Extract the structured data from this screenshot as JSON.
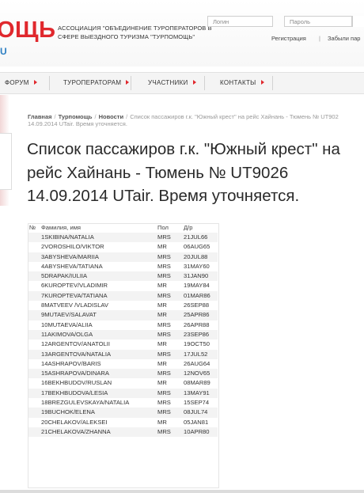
{
  "header": {
    "logo_text": "ОЩЬ",
    "logo_domain": "U",
    "association_text": "Ассоциация \"Объединение туроператоров в сфере выездного туризма \"ТУРПОМОЩЬ\"",
    "login_placeholder": "Логин",
    "password_placeholder": "Пароль",
    "register_link": "Регистрация",
    "divider": "|",
    "forgot_link": "Забыли пар"
  },
  "nav": {
    "items": [
      {
        "label": "ФОРУМ"
      },
      {
        "label": "ТУРОПЕРАТОРАМ"
      },
      {
        "label": "УЧАСТНИКИ"
      },
      {
        "label": "КОНТАКТЫ"
      }
    ]
  },
  "breadcrumb": {
    "home": "Главная",
    "section": "Турпомощь",
    "news": "Новости",
    "current_line1": "Список пассажиров г.к. \"Южный крест\" на рейс Хайнань - Тюмень № UT902",
    "current_line2": "14.09.2014 UTair. Время уточняется."
  },
  "title": "Список пассажиров г.к. \"Южный крест\" на рейс Хайнань - Тюмень № UT9026 14.09.2014 UTair. Время уточняется.",
  "table": {
    "headers": {
      "num": "№",
      "name": "Фамилия, имя",
      "gender": "Пол",
      "dob": "Д/р"
    },
    "rows": [
      {
        "num": "1",
        "name": "SKIBINA/NATALIA",
        "gender": "MRS",
        "dob": "21JUL66"
      },
      {
        "num": "2",
        "name": "VOROSHILO/VIKTOR",
        "gender": "MR",
        "dob": "06AUG65"
      },
      {
        "num": "3",
        "name": "ABYSHEVA/MARIIA",
        "gender": "MRS",
        "dob": "20JUL88"
      },
      {
        "num": "4",
        "name": "ABYSHEVA/TATIANA",
        "gender": "MRS",
        "dob": "31MAY60"
      },
      {
        "num": "5",
        "name": "DRAPAK/IULIIA",
        "gender": "MRS",
        "dob": "31JAN90"
      },
      {
        "num": "6",
        "name": "KUROPTEV/VLADIMIR",
        "gender": "MR",
        "dob": "19MAY84"
      },
      {
        "num": "7",
        "name": "KUROPTEVA/TATIANA",
        "gender": "MRS",
        "dob": "01MAR86"
      },
      {
        "num": "8",
        "name": "MATVEEV /VLADISLAV",
        "gender": "MR",
        "dob": "26SEP88"
      },
      {
        "num": "9",
        "name": "MUTAEV/SALAVAT",
        "gender": "MR",
        "dob": "25APR86"
      },
      {
        "num": "10",
        "name": "MUTAEVA/ALIIA",
        "gender": "MRS",
        "dob": "26APR88"
      },
      {
        "num": "11",
        "name": "AKIMOVA/OLGA",
        "gender": "MRS",
        "dob": "23SEP86"
      },
      {
        "num": "12",
        "name": "ARGENTOV/ANATOLII",
        "gender": "MR",
        "dob": "19OCT50"
      },
      {
        "num": "13",
        "name": "ARGENTOVA/NATALIA",
        "gender": "MRS",
        "dob": "17JUL52"
      },
      {
        "num": "14",
        "name": "ASHRAPOV/BARIS",
        "gender": "MR",
        "dob": "26AUG64"
      },
      {
        "num": "15",
        "name": "ASHRAPOVA/DINARA",
        "gender": "MRS",
        "dob": "12NOV65"
      },
      {
        "num": "16",
        "name": "BEKHBUDOV/RUSLAN",
        "gender": "MR",
        "dob": "08MAR89"
      },
      {
        "num": "17",
        "name": "BEKHBUDOVA/LESIA",
        "gender": "MRS",
        "dob": "13MAY91"
      },
      {
        "num": "18",
        "name": "BREZGULEVSKAYA/NATALIA",
        "gender": "MRS",
        "dob": "15SEP74"
      },
      {
        "num": "19",
        "name": "BUCHOK/ELENA",
        "gender": "MRS",
        "dob": "08JUL74"
      },
      {
        "num": "20",
        "name": "CHELAKOV/ALEKSEI",
        "gender": "MR",
        "dob": "05JAN81"
      },
      {
        "num": "21",
        "name": "CHELAKOVA/ZHANNA",
        "gender": "MRS",
        "dob": "10APR80"
      }
    ]
  },
  "colors": {
    "brand_red": "#e0282d",
    "brand_blue": "#2d7fc2"
  }
}
